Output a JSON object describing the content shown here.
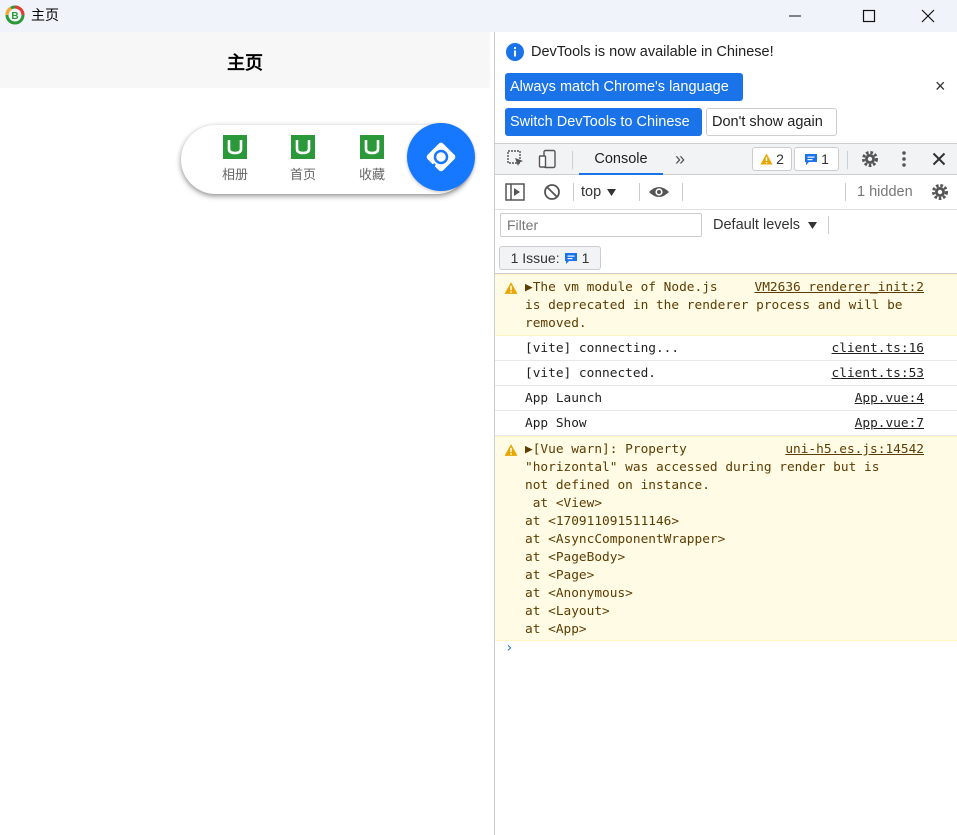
{
  "window": {
    "title": "主页",
    "minimize_label": "—",
    "maximize_label": "☐",
    "close_label": "✕"
  },
  "app": {
    "header_title": "主页",
    "nav_items": [
      {
        "label": "相册",
        "icon": "u-logo-icon"
      },
      {
        "label": "首页",
        "icon": "u-logo-icon"
      },
      {
        "label": "收藏",
        "icon": "u-logo-icon"
      }
    ],
    "fab_icon": "compass-icon",
    "colors": {
      "brand_green": "#2b9939",
      "fab_blue": "#1677ff"
    }
  },
  "devtools": {
    "infobar": {
      "message": "DevTools is now available in Chinese!",
      "always_match_label": "Always match Chrome's language",
      "switch_label": "Switch DevTools to Chinese",
      "dont_show_label": "Don't show again",
      "close_label": "×"
    },
    "toolbar": {
      "tab_console": "Console",
      "more_tabs": "»",
      "warnings_count": "2",
      "messages_count": "1"
    },
    "console_toolbar": {
      "context": "top",
      "hidden": "1 hidden"
    },
    "filter": {
      "placeholder": "Filter",
      "levels": "Default levels"
    },
    "issues": {
      "label": "1 Issue:",
      "count": "1"
    },
    "messages": [
      {
        "type": "warn",
        "lines": [
          "▶The vm module of Node.js ",
          "is deprecated in the renderer process and will be",
          "removed."
        ],
        "source": "VM2636 renderer_init:2"
      },
      {
        "type": "log",
        "lines": [
          "[vite] connecting..."
        ],
        "source": "client.ts:16"
      },
      {
        "type": "log",
        "lines": [
          "[vite] connected."
        ],
        "source": "client.ts:53"
      },
      {
        "type": "log",
        "lines": [
          "App Launch"
        ],
        "source": "App.vue:4"
      },
      {
        "type": "log",
        "lines": [
          "App Show"
        ],
        "source": "App.vue:7"
      },
      {
        "type": "warn",
        "lines": [
          "▶[Vue warn]: Property",
          "\"horizontal\" was accessed during render but is",
          "not defined on instance.",
          " at <View>",
          "at <170911091511146>",
          "at <AsyncComponentWrapper>",
          "at <PageBody>",
          "at <Page>",
          "at <Anonymous>",
          "at <Layout>",
          "at <App>"
        ],
        "source": "uni-h5.es.js:14542"
      }
    ],
    "prompt": "›"
  }
}
